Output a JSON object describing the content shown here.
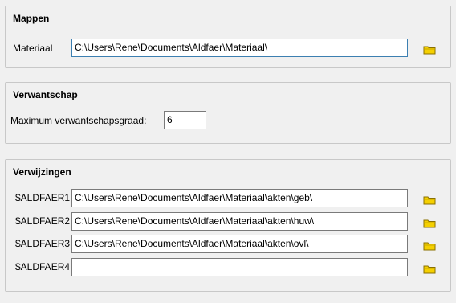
{
  "mappen": {
    "title": "Mappen",
    "materiaal_label": "Materiaal",
    "materiaal_value": "C:\\Users\\Rene\\Documents\\Aldfaer\\Materiaal\\"
  },
  "verwantschap": {
    "title": "Verwantschap",
    "max_label": "Maximum verwantschapsgraad:",
    "max_value": "6"
  },
  "verwijzingen": {
    "title": "Verwijzingen",
    "rows": [
      {
        "label": "$ALDFAER1",
        "value": "C:\\Users\\Rene\\Documents\\Aldfaer\\Materiaal\\akten\\geb\\"
      },
      {
        "label": "$ALDFAER2",
        "value": "C:\\Users\\Rene\\Documents\\Aldfaer\\Materiaal\\akten\\huw\\"
      },
      {
        "label": "$ALDFAER3",
        "value": "C:\\Users\\Rene\\Documents\\Aldfaer\\Materiaal\\akten\\ovl\\"
      },
      {
        "label": "$ALDFAER4",
        "value": ""
      }
    ]
  },
  "icons": {
    "browse": "folder-icon"
  },
  "colors": {
    "folder_fill": "#f5d000",
    "folder_stroke": "#8a7000",
    "focus_border": "#3c7fb1"
  }
}
